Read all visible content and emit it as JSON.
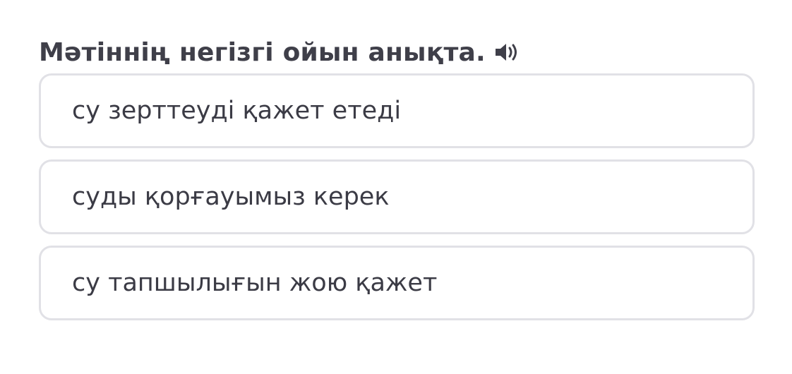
{
  "question": {
    "text": "Мәтіннің негізгі ойын анықта.",
    "audio_icon": "speaker-icon"
  },
  "options": [
    {
      "label": "су зерттеуді қажет етеді"
    },
    {
      "label": "суды қорғауымыз керек"
    },
    {
      "label": "су тапшылығын жою қажет"
    }
  ],
  "colors": {
    "text": "#3c3c46",
    "option_border": "#e1e1e6",
    "background": "#ffffff"
  }
}
